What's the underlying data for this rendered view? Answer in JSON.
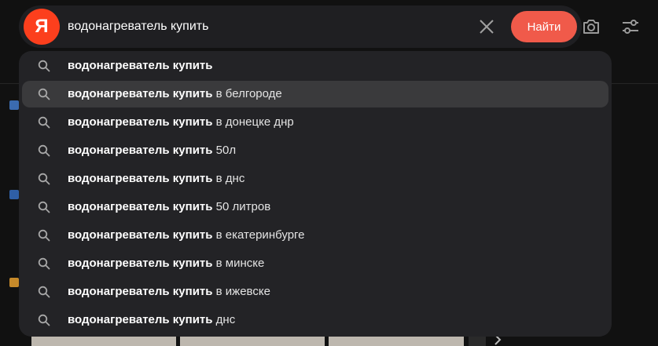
{
  "search": {
    "logo": "Я",
    "query": "водонагреватель купить",
    "button_label": "Найти"
  },
  "suggestions": [
    {
      "bold": "водонагреватель купить",
      "rest": ""
    },
    {
      "bold": "водонагреватель купить",
      "rest": " в белгороде"
    },
    {
      "bold": "водонагреватель купить",
      "rest": " в донецке днр"
    },
    {
      "bold": "водонагреватель купить",
      "rest": " 50л"
    },
    {
      "bold": "водонагреватель купить",
      "rest": " в днс"
    },
    {
      "bold": "водонагреватель купить",
      "rest": " 50 литров"
    },
    {
      "bold": "водонагреватель купить",
      "rest": " в екатеринбурге"
    },
    {
      "bold": "водонагреватель купить",
      "rest": " в минске"
    },
    {
      "bold": "водонагреватель купить",
      "rest": " в ижевске"
    },
    {
      "bold": "водонагреватель купить",
      "rest": " днс"
    }
  ],
  "active_suggestion": 1,
  "icons": {
    "search": "search-icon",
    "clear": "close-icon",
    "camera": "camera-icon",
    "filters": "filters-icon"
  },
  "colors": {
    "brand": "#fc3f1d",
    "button": "#f05a4a",
    "panel": "#232326",
    "highlight": "#3a3a3c"
  }
}
